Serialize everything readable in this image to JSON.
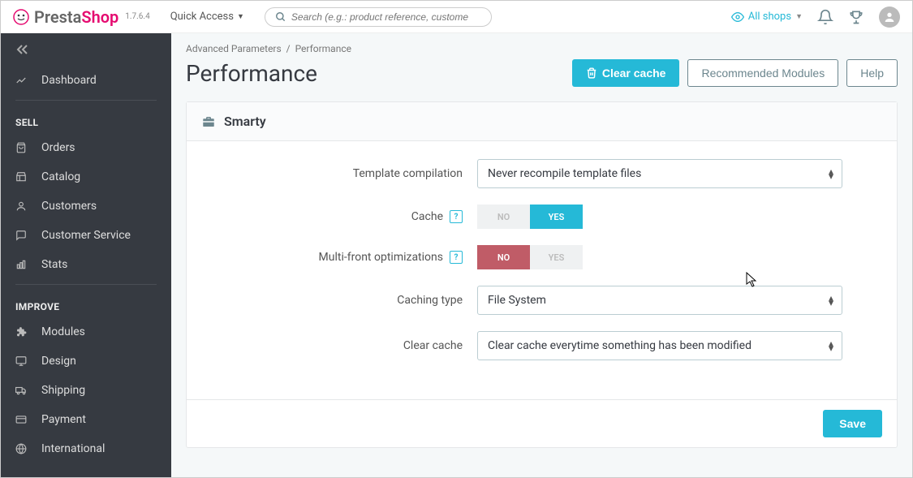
{
  "header": {
    "logo1": "Presta",
    "logo2": "Shop",
    "version": "1.7.6.4",
    "quick_access": "Quick Access",
    "search_placeholder": "Search (e.g.: product reference, custome",
    "shop_selector": "All shops"
  },
  "sidebar": {
    "dashboard": "Dashboard",
    "section_sell": "SELL",
    "items_sell": [
      "Orders",
      "Catalog",
      "Customers",
      "Customer Service",
      "Stats"
    ],
    "section_improve": "IMPROVE",
    "items_improve": [
      "Modules",
      "Design",
      "Shipping",
      "Payment",
      "International"
    ]
  },
  "breadcrumb": {
    "a": "Advanced Parameters",
    "sep": "/",
    "b": "Performance"
  },
  "page_title": "Performance",
  "buttons": {
    "clear_cache": "Clear cache",
    "recommended": "Recommended Modules",
    "help": "Help",
    "save": "Save"
  },
  "card": {
    "title": "Smarty",
    "rows": {
      "template_compilation": {
        "label": "Template compilation",
        "value": "Never recompile template files"
      },
      "cache": {
        "label": "Cache",
        "no": "NO",
        "yes": "YES"
      },
      "multi_front": {
        "label": "Multi-front optimizations",
        "no": "NO",
        "yes": "YES"
      },
      "caching_type": {
        "label": "Caching type",
        "value": "File System"
      },
      "clear_cache": {
        "label": "Clear cache",
        "value": "Clear cache everytime something has been modified"
      }
    }
  }
}
